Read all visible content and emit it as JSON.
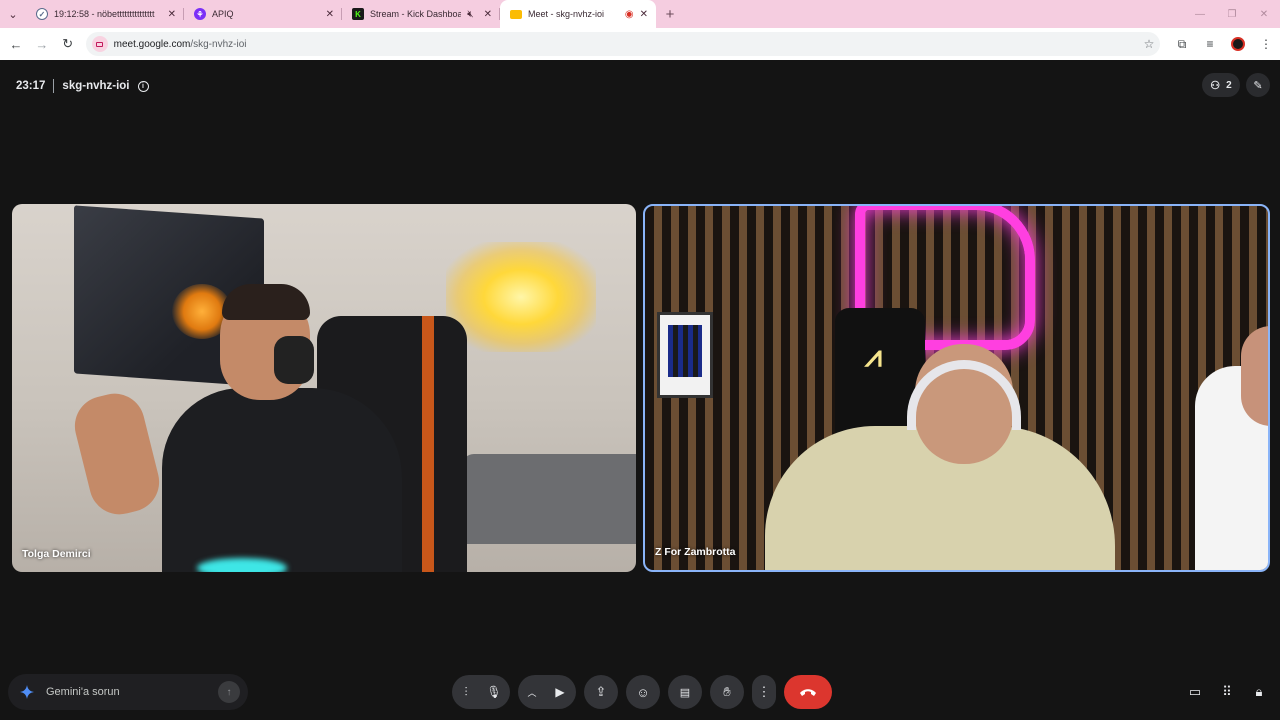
{
  "browser": {
    "tabs": [
      {
        "title": "19:12:58 - nöbettttttttttttttt",
        "icon": "clock-check-icon",
        "active": false
      },
      {
        "title": "APIQ",
        "icon": "apiq-logo-icon",
        "active": false
      },
      {
        "title": "Stream - Kick Dashboard",
        "icon": "kick-logo-icon",
        "active": false,
        "muted": true
      },
      {
        "title": "Meet - skg-nvhz-ioi",
        "icon": "meet-logo-icon",
        "active": true,
        "recording": true
      }
    ],
    "new_tab": "+",
    "url_host": "meet.google.com",
    "url_path": "/skg-nvhz-ioi"
  },
  "meeting": {
    "time": "23:17",
    "code": "skg-nvhz-ioi",
    "participant_count": "2"
  },
  "participants": [
    {
      "name": "Tolga Demirci",
      "speaking": false
    },
    {
      "name": "Z For Zambrotta",
      "speaking": true
    }
  ],
  "gemini": {
    "placeholder": "Gemini'a sorun"
  },
  "colors": {
    "tabbar_bg": "#f5cde0",
    "meet_bg": "#141414",
    "active_speaker_border": "#8ab4f8",
    "end_call": "#dc362e",
    "control_bg": "#333438"
  }
}
